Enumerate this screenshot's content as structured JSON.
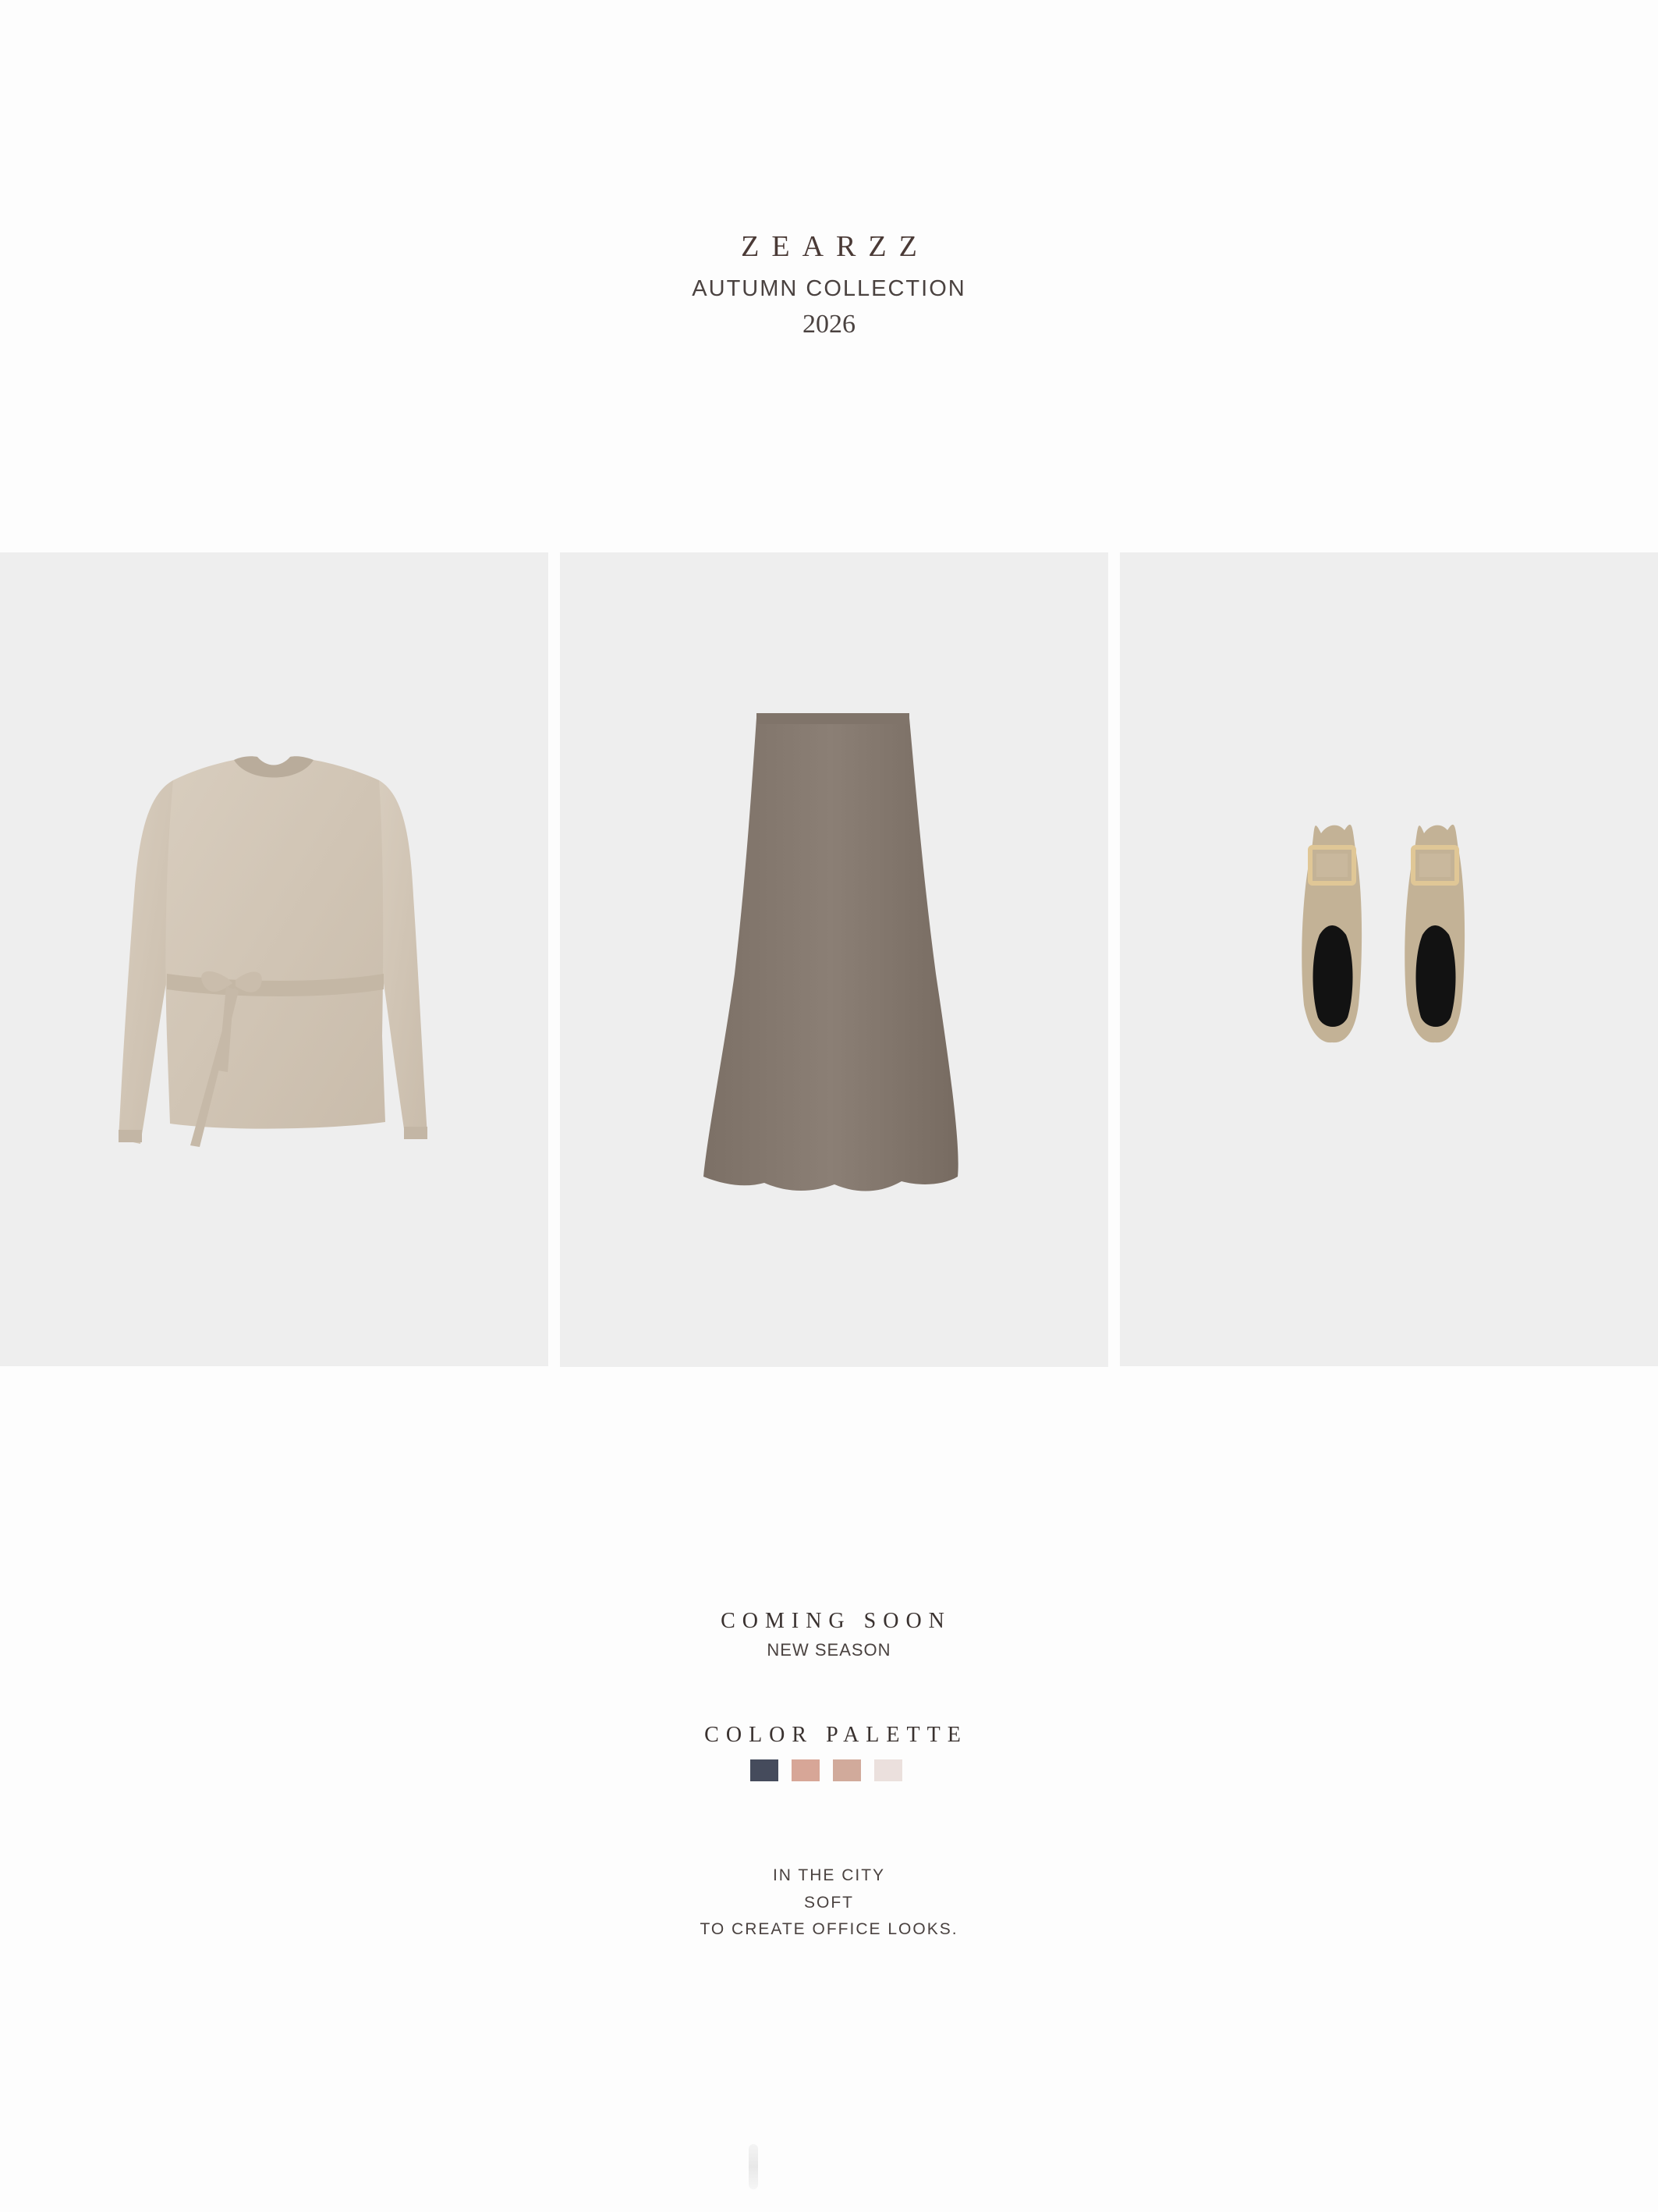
{
  "header": {
    "brand": "ZEARZZ",
    "collection": "AUTUMN COLLECTION",
    "year": "2026"
  },
  "products": [
    {
      "name": "sweater",
      "icon": "tie-waist-sweater-image",
      "color": "#d2c6b6"
    },
    {
      "name": "skirt",
      "icon": "midi-skirt-image",
      "color": "#85786e"
    },
    {
      "name": "flats",
      "icon": "buckle-flats-image",
      "color": "#c2b297"
    }
  ],
  "coming": {
    "title": "COMING SOON",
    "subtitle": "NEW SEASON"
  },
  "palette": {
    "title": "COLOR PALETTE",
    "colors": [
      "#454b5c",
      "#d7a697",
      "#d1aa9b",
      "#ebe0dd"
    ]
  },
  "tagline": {
    "line1": "IN THE CITY",
    "line2": "SOFT",
    "line3": "TO CREATE OFFICE LOOKS."
  }
}
